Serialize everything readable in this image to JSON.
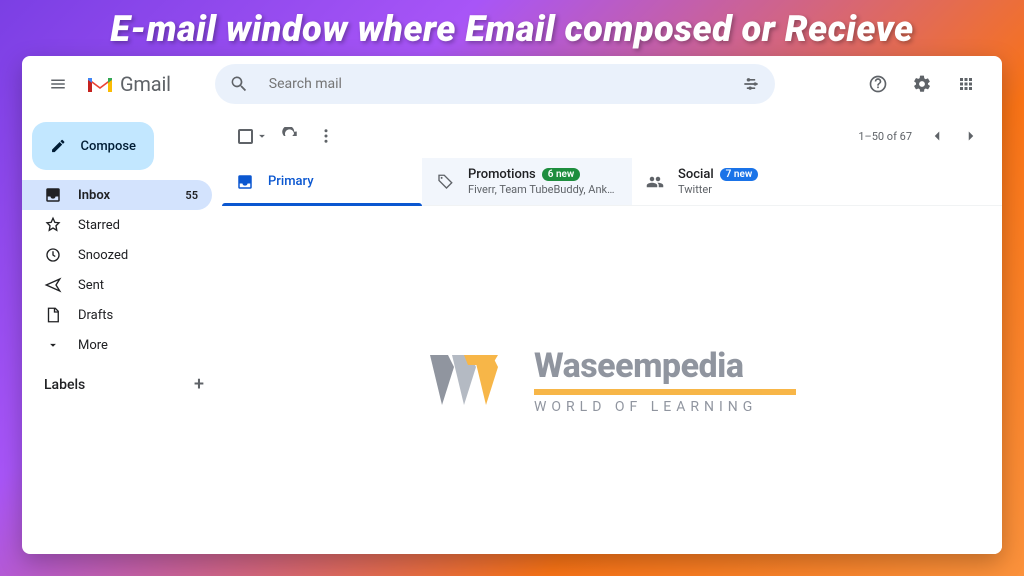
{
  "page_title": "E-mail window where Email composed or Recieve",
  "brand": "Gmail",
  "search": {
    "placeholder": "Search mail"
  },
  "compose_label": "Compose",
  "sidebar": {
    "items": [
      {
        "label": "Inbox",
        "count": "55"
      },
      {
        "label": "Starred"
      },
      {
        "label": "Snoozed"
      },
      {
        "label": "Sent"
      },
      {
        "label": "Drafts"
      },
      {
        "label": "More"
      }
    ],
    "labels_header": "Labels"
  },
  "toolbar": {
    "pagination": "1–50 of 67"
  },
  "tabs": {
    "primary": {
      "label": "Primary"
    },
    "promotions": {
      "label": "Promotions",
      "badge": "6 new",
      "sub": "Fiverr, Team TubeBuddy, Ankan ..."
    },
    "social": {
      "label": "Social",
      "badge": "7 new",
      "sub": "Twitter"
    }
  },
  "watermark": {
    "title": "Waseempedia",
    "subtitle": "WORLD OF LEARNING"
  }
}
